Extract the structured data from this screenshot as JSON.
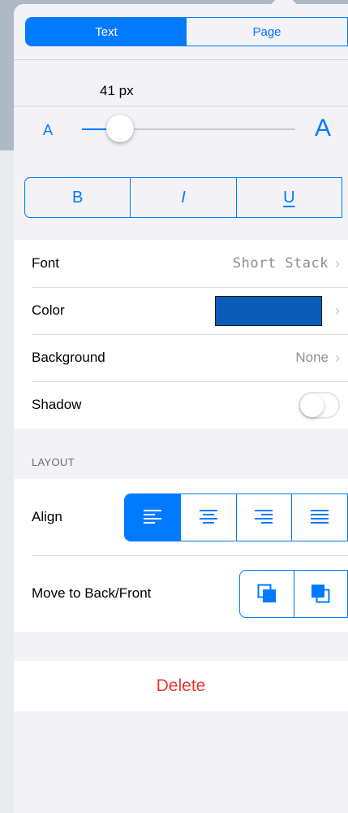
{
  "tabs": [
    {
      "label": "Text",
      "active": true
    },
    {
      "label": "Page",
      "active": false
    }
  ],
  "font_size": {
    "value_label": "41 px",
    "min_label": "A",
    "max_label": "A",
    "slider_fraction": 0.18
  },
  "text_style": {
    "bold": "B",
    "italic": "I",
    "underline": "U"
  },
  "rows": {
    "font": {
      "label": "Font",
      "value": "Short Stack"
    },
    "color": {
      "label": "Color",
      "swatch": "#0A5CB8"
    },
    "background": {
      "label": "Background",
      "value": "None"
    },
    "shadow": {
      "label": "Shadow",
      "enabled": false
    }
  },
  "layout": {
    "header": "LAYOUT",
    "align": {
      "label": "Align",
      "options": [
        "left",
        "center",
        "right",
        "justify"
      ],
      "selected": "left"
    },
    "order": {
      "label": "Move to Back/Front",
      "options": [
        "send-to-back",
        "bring-to-front"
      ]
    }
  },
  "delete_label": "Delete",
  "colors": {
    "accent": "#007AFF",
    "destructive": "#E53935"
  }
}
